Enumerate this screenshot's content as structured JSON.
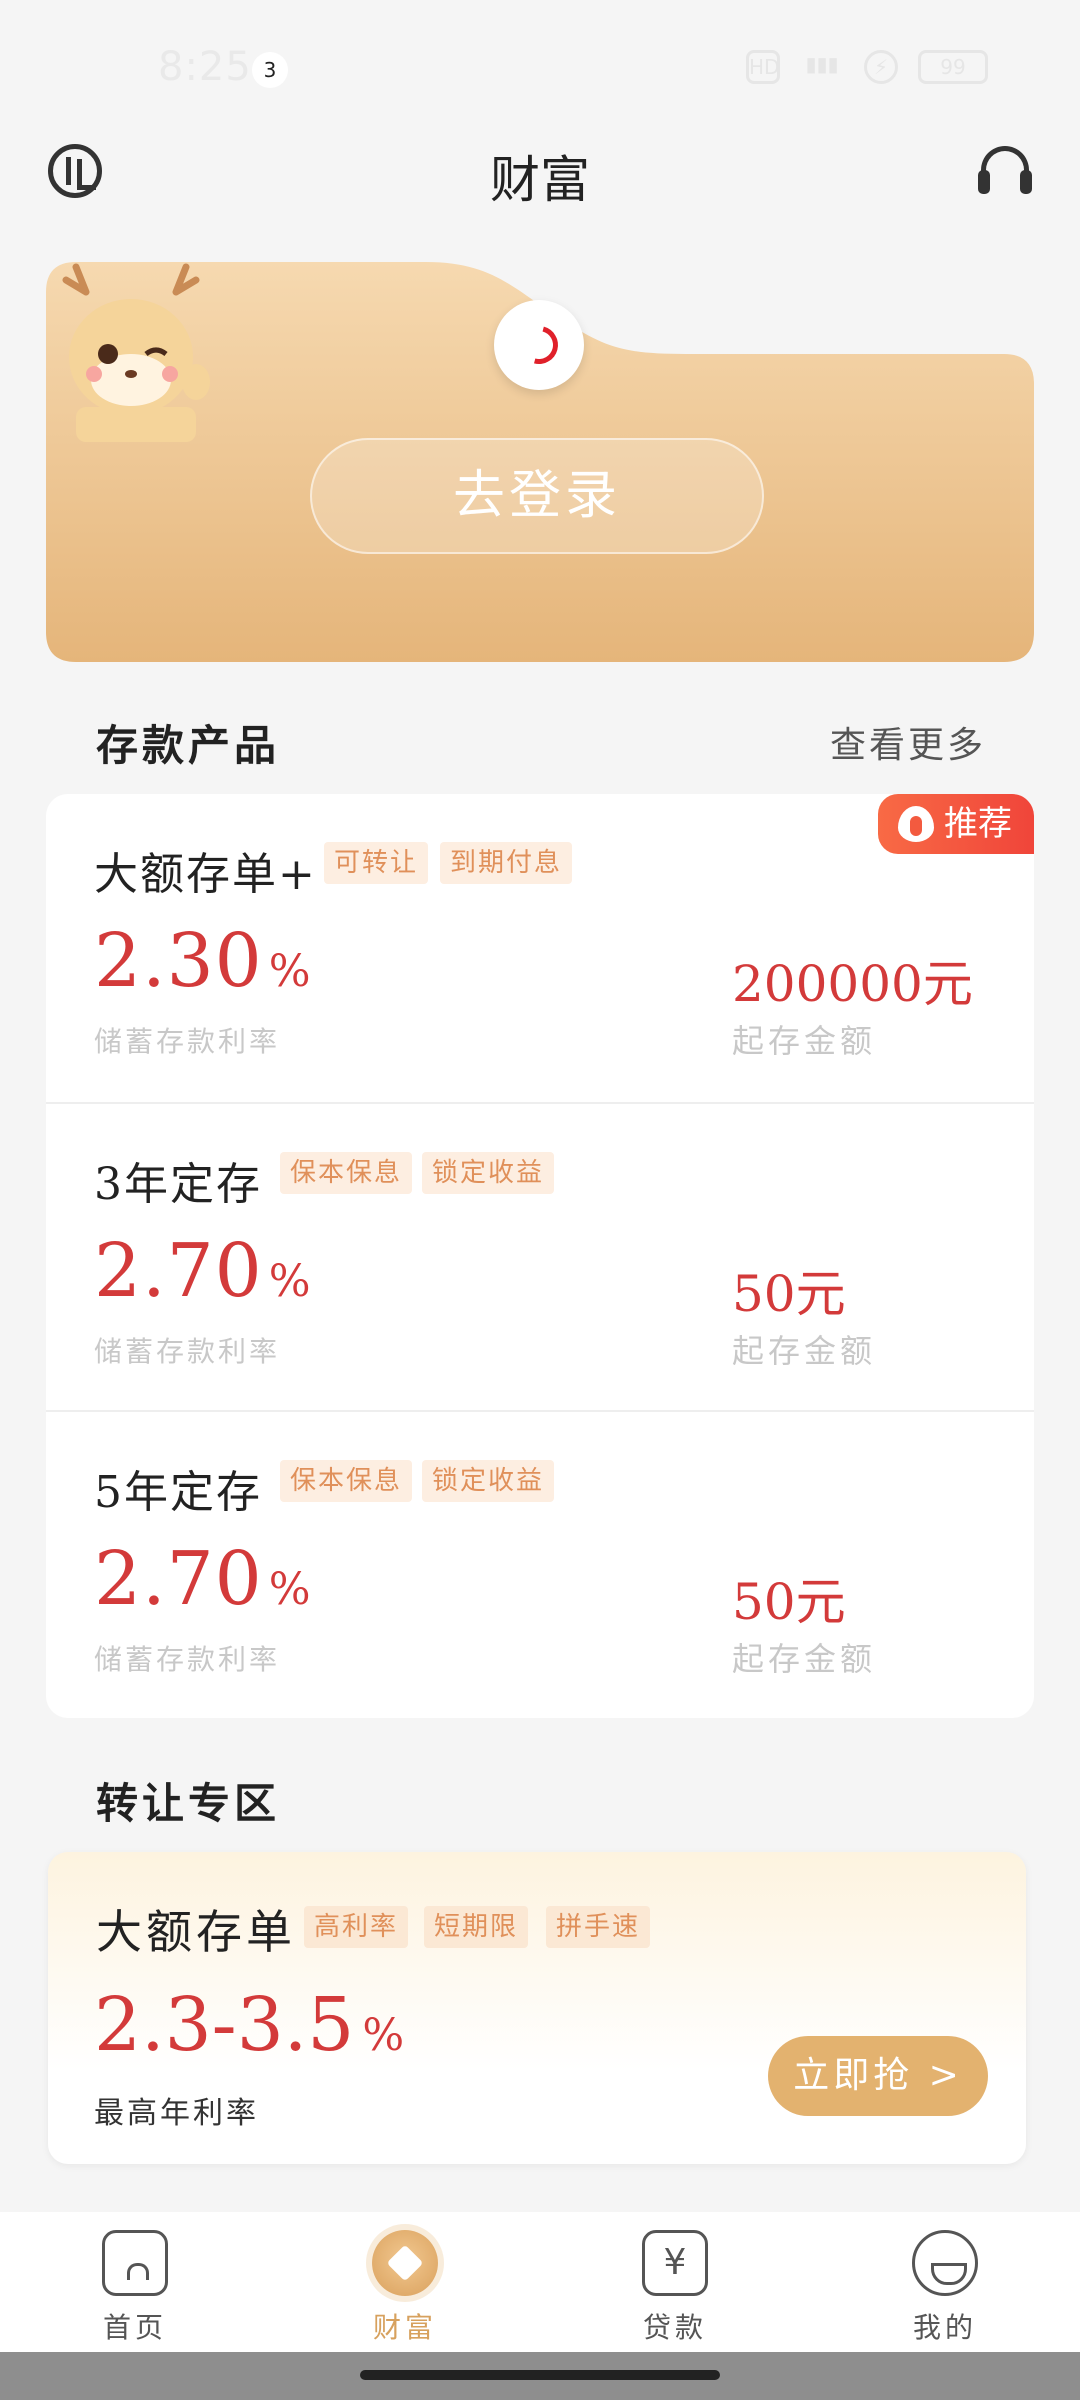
{
  "status_bar": {
    "time": "8:25",
    "notification_count": "3",
    "battery": "99"
  },
  "header": {
    "title": "财富"
  },
  "hero": {
    "login_label": "去登录"
  },
  "deposit_section": {
    "title": "存款产品",
    "see_more": "查看更多",
    "recommend_badge": "推荐",
    "products": [
      {
        "name": "大额存单+",
        "tags": [
          "可转让",
          "到期付息"
        ],
        "rate": "2.30",
        "rate_unit": "%",
        "rate_label": "储蓄存款利率",
        "min_amount": "200000元",
        "min_label": "起存金额"
      },
      {
        "name": "3年定存",
        "tags": [
          "保本保息",
          "锁定收益"
        ],
        "rate": "2.70",
        "rate_unit": "%",
        "rate_label": "储蓄存款利率",
        "min_amount": "50元",
        "min_label": "起存金额"
      },
      {
        "name": "5年定存",
        "tags": [
          "保本保息",
          "锁定收益"
        ],
        "rate": "2.70",
        "rate_unit": "%",
        "rate_label": "储蓄存款利率",
        "min_amount": "50元",
        "min_label": "起存金额"
      }
    ]
  },
  "transfer_section": {
    "title": "转让专区",
    "card": {
      "name": "大额存单",
      "tags": [
        "高利率",
        "短期限",
        "拼手速"
      ],
      "rate": "2.3-3.5",
      "rate_unit": "%",
      "rate_label": "最高年利率",
      "button": "立即抢 >"
    }
  },
  "tab_bar": {
    "items": [
      {
        "label": "首页",
        "icon": "home-icon"
      },
      {
        "label": "财富",
        "icon": "wealth-icon",
        "active": true
      },
      {
        "label": "贷款",
        "icon": "loan-icon",
        "glyph": "¥"
      },
      {
        "label": "我的",
        "icon": "profile-icon"
      }
    ]
  },
  "colors": {
    "accent_gold": "#e3b26f",
    "rate_red": "#d33a3a",
    "badge_red": "#f0453a"
  }
}
